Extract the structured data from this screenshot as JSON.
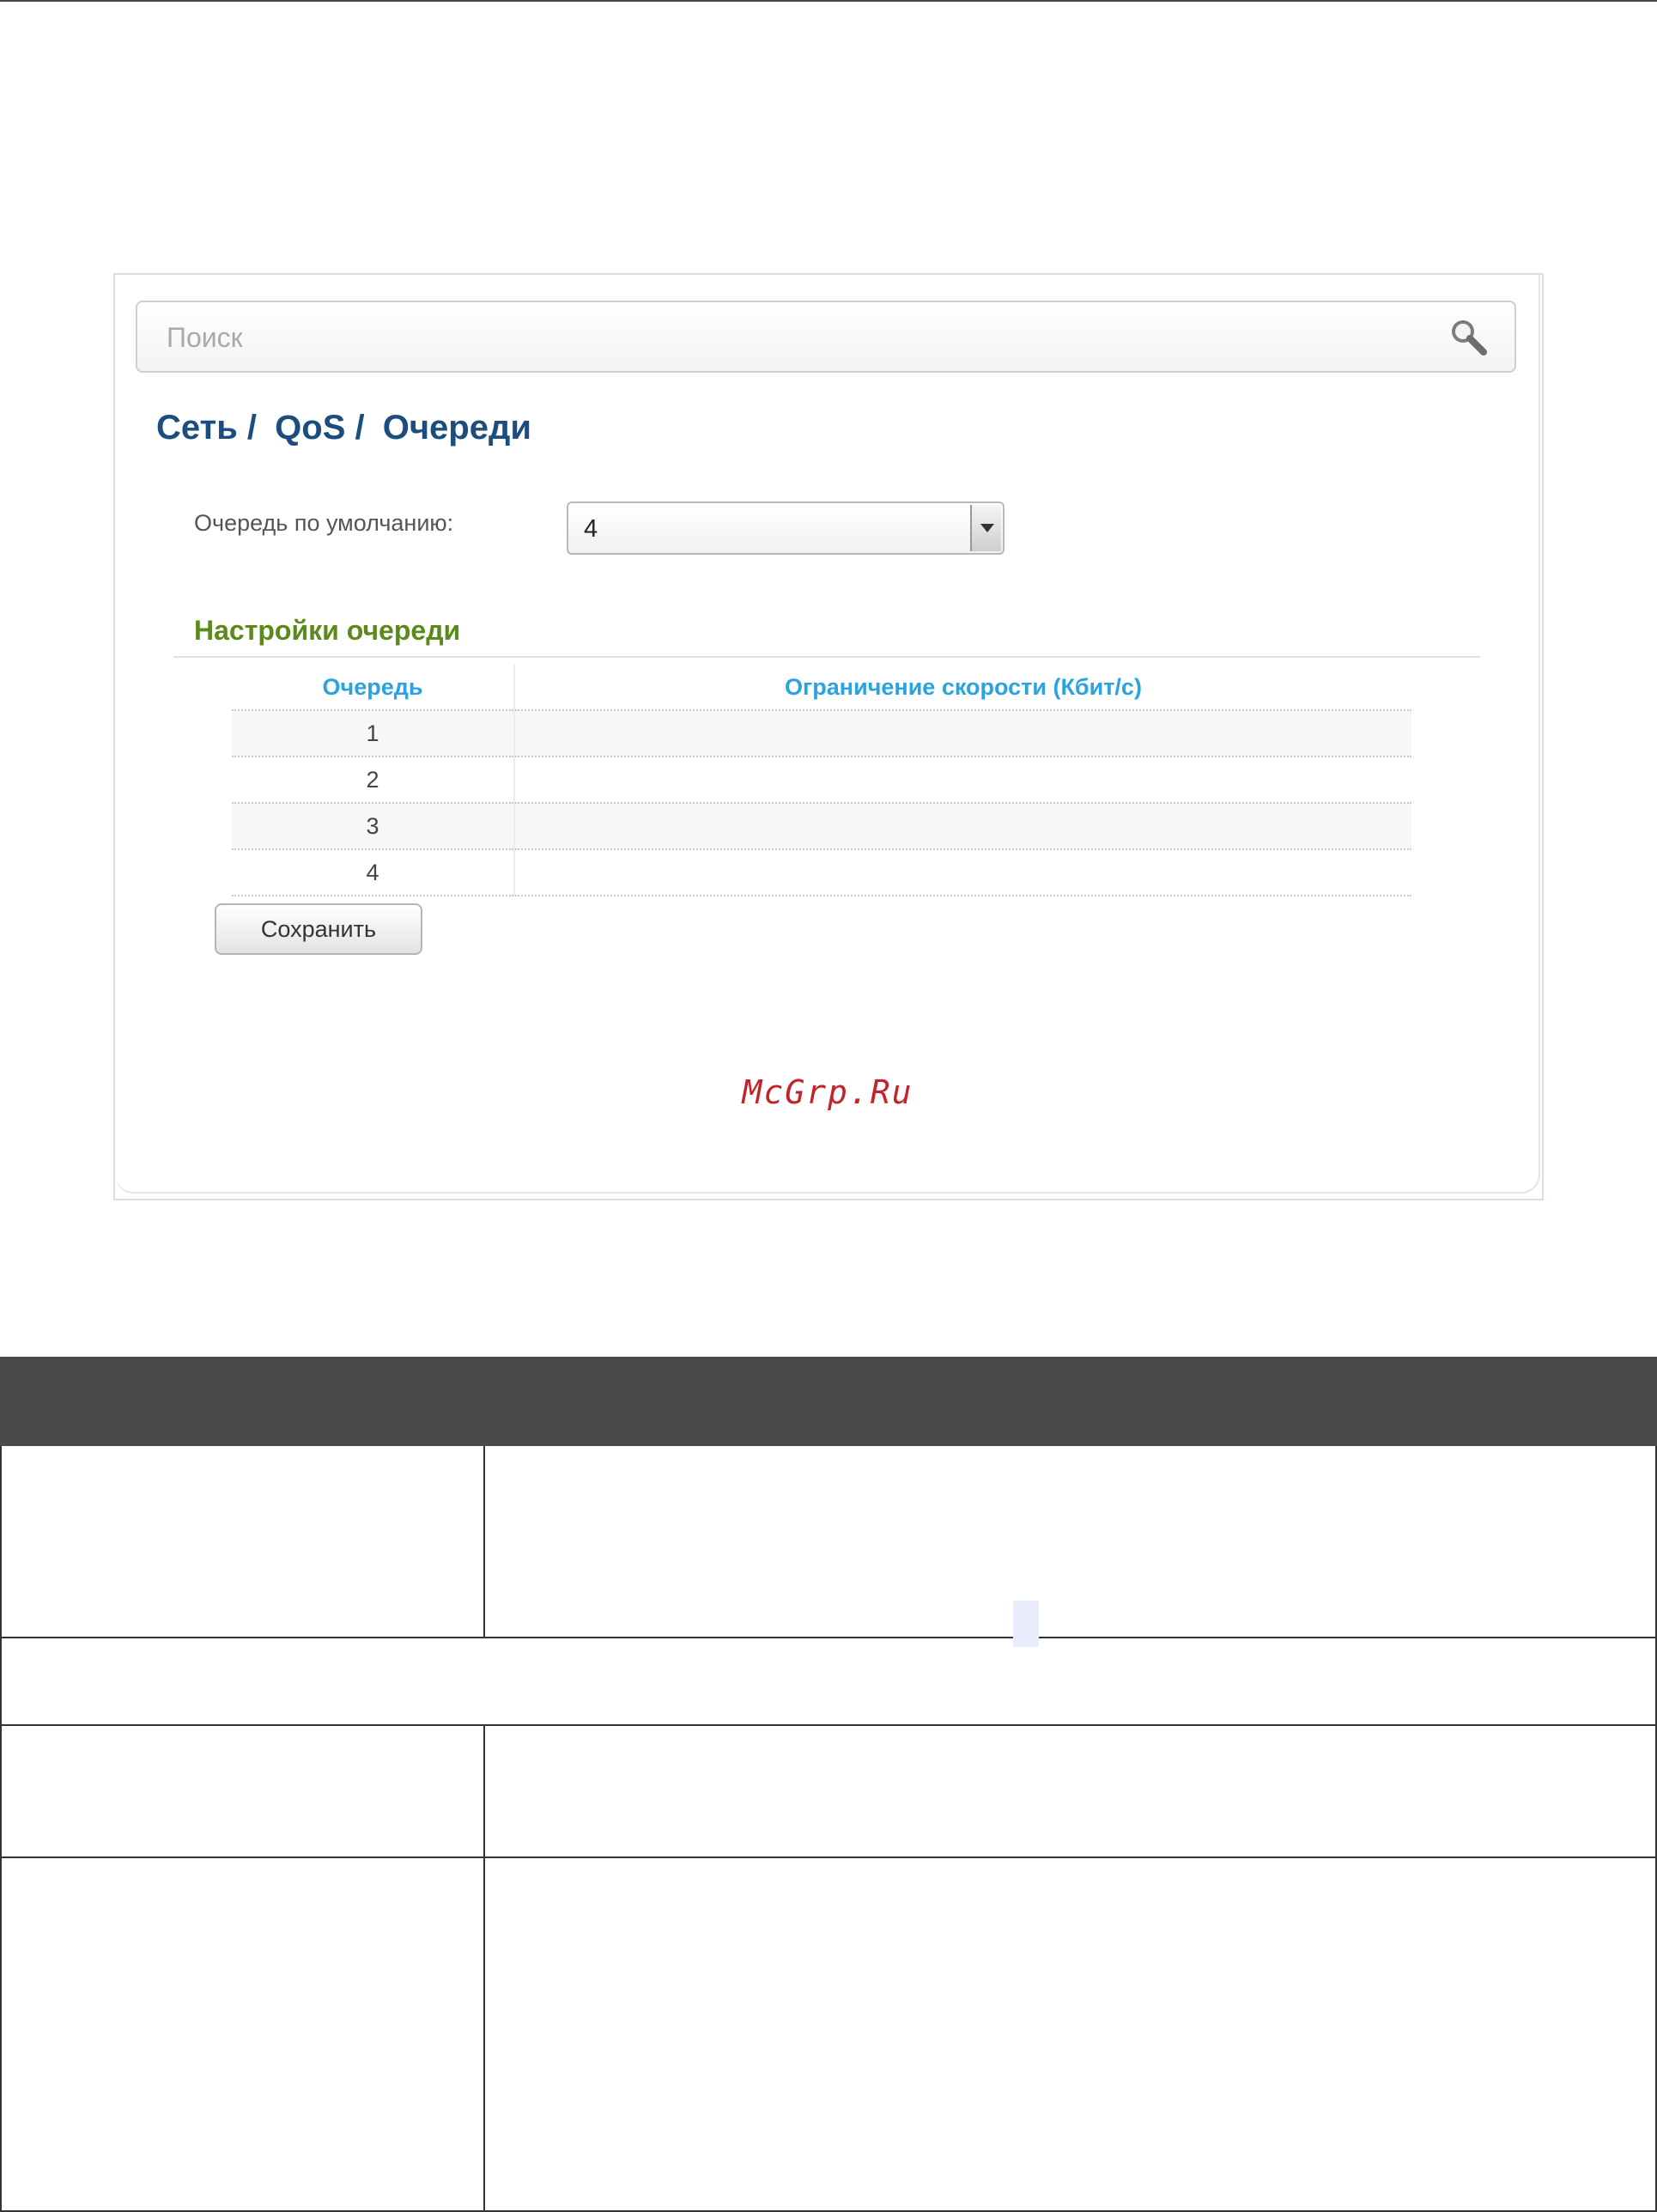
{
  "search": {
    "placeholder": "Поиск"
  },
  "breadcrumb": [
    "Сеть /",
    "QoS /",
    "Очереди"
  ],
  "default_queue": {
    "label": "Очередь по умолчанию:",
    "value": "4"
  },
  "queue_settings": {
    "title": "Настройки очереди",
    "columns": [
      "Очередь",
      "Ограничение скорости (Кбит/с)"
    ],
    "rows": [
      {
        "queue": "1",
        "limit": ""
      },
      {
        "queue": "2",
        "limit": ""
      },
      {
        "queue": "3",
        "limit": ""
      },
      {
        "queue": "4",
        "limit": ""
      }
    ]
  },
  "save_button": "Сохранить",
  "watermark": "McGrp.Ru",
  "colors": {
    "breadcrumb": "#1b4d7e",
    "section_title": "#5a8a1a",
    "table_header": "#2aa3e0",
    "description_header": "#4a4a4a",
    "watermark": "#c3242b"
  }
}
